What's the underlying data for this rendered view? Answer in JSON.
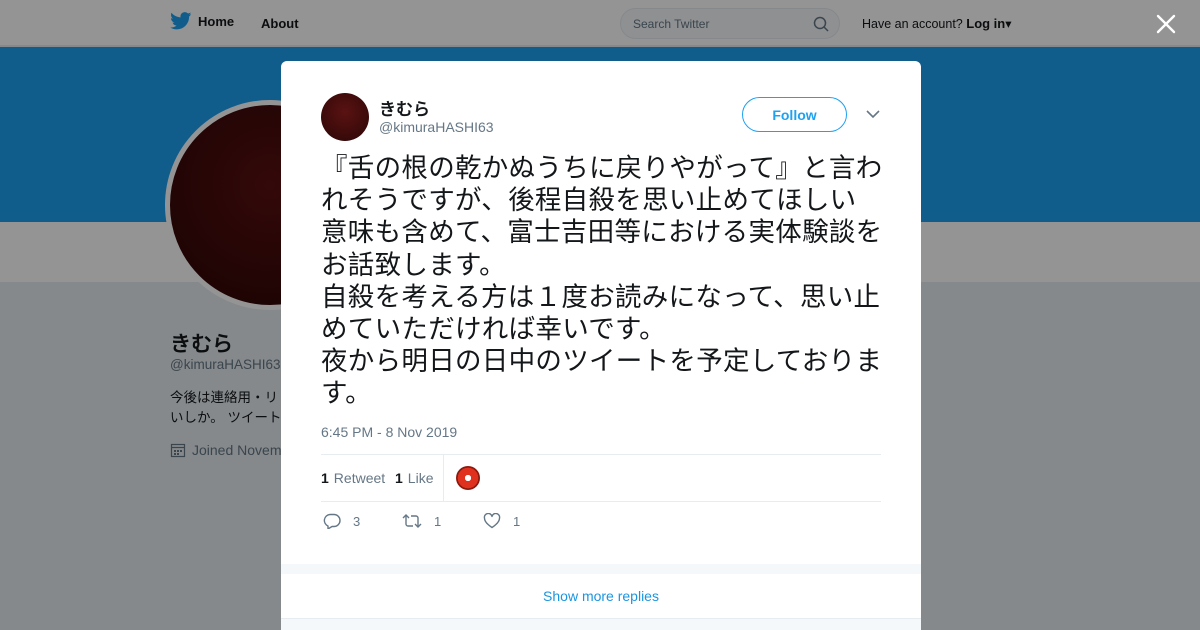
{
  "topbar": {
    "home_label": "Home",
    "about_label": "About",
    "search_placeholder": "Search Twitter",
    "account_prompt": "Have an account?",
    "login_label": "Log in"
  },
  "profile": {
    "name": "きむら",
    "handle": "@kimuraHASHI63",
    "bio_line1": "今後は連絡用・リ",
    "bio_line2": "いしか。 ツイート",
    "joined": "Joined Novem"
  },
  "tweet": {
    "author_name": "きむら",
    "author_handle": "@kimuraHASHI63",
    "follow_label": "Follow",
    "text": "『舌の根の乾かぬうちに戻りやがって』と言われそうですが、後程自殺を思い止めてほしい意味も含めて、富士吉田等における実体験談をお話致します。\n自殺を考える方は１度お読みになって、思い止めていただければ幸いです。\n夜から明日の日中のツイートを予定しております。",
    "timestamp": "6:45 PM - 8 Nov 2019",
    "retweet_count": "1",
    "retweet_label": "Retweet",
    "like_count": "1",
    "like_label": "Like",
    "reply_action_count": "3",
    "retweet_action_count": "1",
    "like_action_count": "1"
  },
  "show_more_label": "Show more replies",
  "colors": {
    "brand": "#1da1f2",
    "link": "#1b95e0",
    "muted": "#657786"
  }
}
